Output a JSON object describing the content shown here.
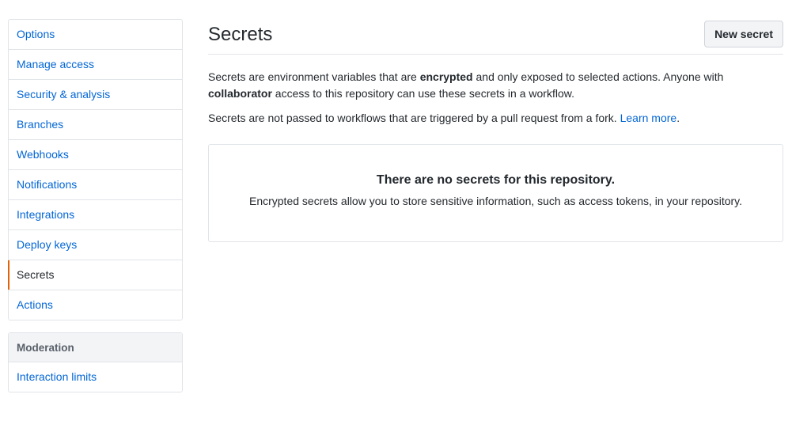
{
  "sidebar": {
    "items": [
      {
        "label": "Options"
      },
      {
        "label": "Manage access"
      },
      {
        "label": "Security & analysis"
      },
      {
        "label": "Branches"
      },
      {
        "label": "Webhooks"
      },
      {
        "label": "Notifications"
      },
      {
        "label": "Integrations"
      },
      {
        "label": "Deploy keys"
      },
      {
        "label": "Secrets",
        "selected": true
      },
      {
        "label": "Actions"
      }
    ],
    "moderation": {
      "heading": "Moderation",
      "items": [
        {
          "label": "Interaction limits"
        }
      ]
    }
  },
  "main": {
    "title": "Secrets",
    "new_secret_label": "New secret",
    "description": {
      "part1": "Secrets are environment variables that are ",
      "bold1": "encrypted",
      "part2": " and only exposed to selected actions. Anyone with ",
      "bold2": "collaborator",
      "part3": " access to this repository can use these secrets in a workflow."
    },
    "note": {
      "text": "Secrets are not passed to workflows that are triggered by a pull request from a fork. ",
      "link": "Learn more",
      "end": "."
    },
    "blankslate": {
      "title": "There are no secrets for this repository.",
      "text": "Encrypted secrets allow you to store sensitive information, such as access tokens, in your repository."
    }
  },
  "colors": {
    "link": "#0366d6",
    "selected_accent": "#e36209",
    "border": "#e1e4e8"
  }
}
